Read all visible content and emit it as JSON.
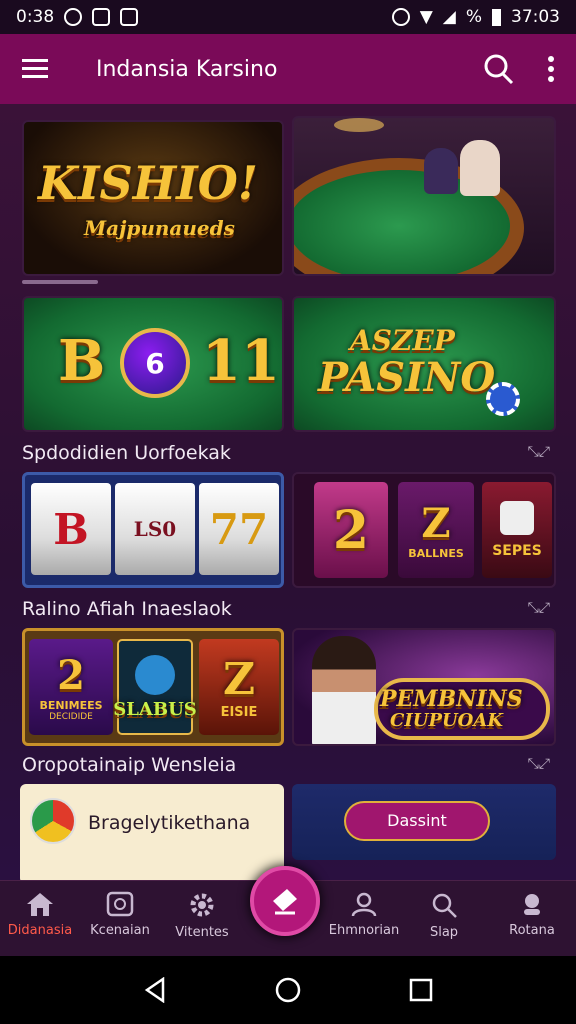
{
  "status_bar": {
    "time": "0:38",
    "clock": "37:03",
    "battery_text": "%"
  },
  "app_bar": {
    "title": "Indansia Karsino"
  },
  "banners": {
    "b1_line1": "KISHIO!",
    "b1_line2": "Majpunaueds",
    "b3_text": "B",
    "b3_num": "11",
    "b3_ball": "6",
    "b4_line1": "ASZEP",
    "b4_line2": "PASINO"
  },
  "sections": [
    {
      "title": "Spdodidien Uorfoekak"
    },
    {
      "title": "Ralino Afiah Inaeslaok"
    },
    {
      "title": "Oropotainaip Wensleia"
    }
  ],
  "slots_row": {
    "reels": [
      "B",
      "LS0",
      "77"
    ],
    "tiles": [
      "2",
      "BALLNES",
      "SEPES"
    ]
  },
  "games_row": {
    "t1_num": "2",
    "t1_label": "BENIMEES",
    "t1_sub": "DECIDIDE",
    "t2_label": "SLABUS",
    "t3_num": "Z",
    "t3_label": "EISIE",
    "promo_line1": "PEMBNINS",
    "promo_line2": "CIUPUOAK"
  },
  "bottom_cards": {
    "left_text": "Bragelytikethana",
    "button_label": "Dassint"
  },
  "bottom_nav": [
    {
      "label": "Didanasia",
      "color": "#ff5a4a"
    },
    {
      "label": "Kcenaian",
      "color": "#d8c8dc"
    },
    {
      "label": "Vitentes",
      "color": "#d8c8dc"
    },
    {
      "label": "Ehmnorian",
      "color": "#d8c8dc"
    },
    {
      "label": "Slap",
      "color": "#d8c8dc"
    },
    {
      "label": "Rotana",
      "color": "#d8c8dc"
    }
  ],
  "accent": "#7a0a58"
}
